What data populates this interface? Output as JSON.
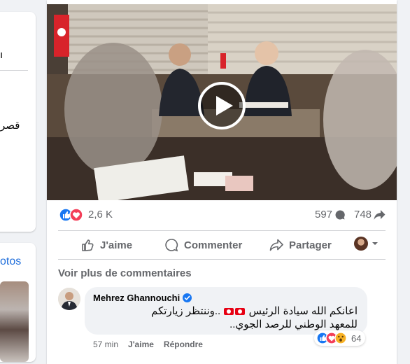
{
  "left_panel": {
    "fragment_1": "ı",
    "fragment_2": "قصر",
    "photos_label": "otos"
  },
  "post": {
    "reactions_count": "2,6 K",
    "comments_count": "597",
    "shares_count": "748",
    "actions": {
      "like": "J'aime",
      "comment": "Commenter",
      "share": "Partager"
    },
    "more_comments": "Voir plus de commentaires"
  },
  "comment": {
    "author": "Mehrez Ghannouchi",
    "text_part1": "اعانكم الله سيادة الرئيس",
    "text_part2": "..وننتظر زيارتكم للمعهد الوطني للرصد الجوي..",
    "time": "57 min",
    "like": "J'aime",
    "reply": "Répondre",
    "reaction_count": "64"
  },
  "colors": {
    "like_blue": "#1877f2",
    "love_red": "#f33e58",
    "secondary_text": "#65676b",
    "link_blue": "#216fdb"
  },
  "icons": [
    "like-icon",
    "love-icon",
    "comment-icon",
    "share-icon",
    "play-icon",
    "verified-icon",
    "chevron-down-icon",
    "wow-icon"
  ]
}
